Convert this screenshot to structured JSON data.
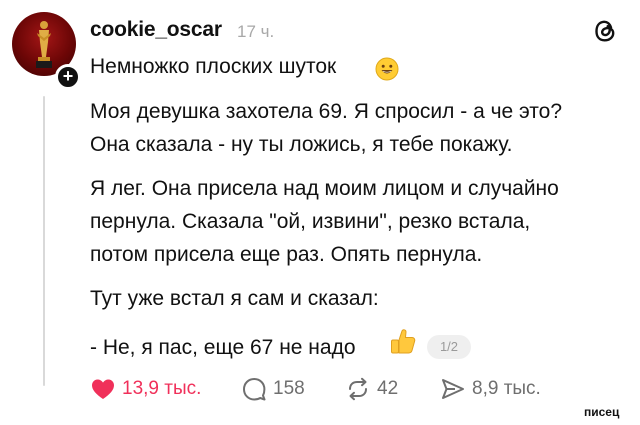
{
  "post": {
    "username": "cookie_oscar",
    "time": "17 ч.",
    "subtitle": "Немножко плоских шуток",
    "paragraphs": [
      [
        "Моя девушка захотела 69. Я спросил - а че это?",
        "Она сказала - ну ты ложись, я тебе покажу."
      ],
      [
        "Я лег. Она присела над моим лицом и случайно",
        "пернула. Сказала \"ой, извини\", резко встала,",
        "потом присела еще раз. Опять пернула."
      ],
      [
        "Тут уже встал я сам и сказал:"
      ],
      [
        "- Не, я пас, еще 67 не надо"
      ]
    ],
    "page_indicator": "1/2"
  },
  "actions": {
    "likes": "13,9 тыс.",
    "comments": "158",
    "reposts": "42",
    "shares": "8,9 тыс."
  },
  "watermark": "писец",
  "colors": {
    "like": "#f0305a",
    "muted": "#6f6f6f",
    "thread_line": "#d9d9d9"
  },
  "icons": [
    "oscar-statue-avatar",
    "follow-plus-icon",
    "threads-logo-icon",
    "smiley-emoji-icon",
    "thumbs-up-emoji-icon",
    "heart-icon",
    "comment-icon",
    "repost-icon",
    "share-icon"
  ]
}
